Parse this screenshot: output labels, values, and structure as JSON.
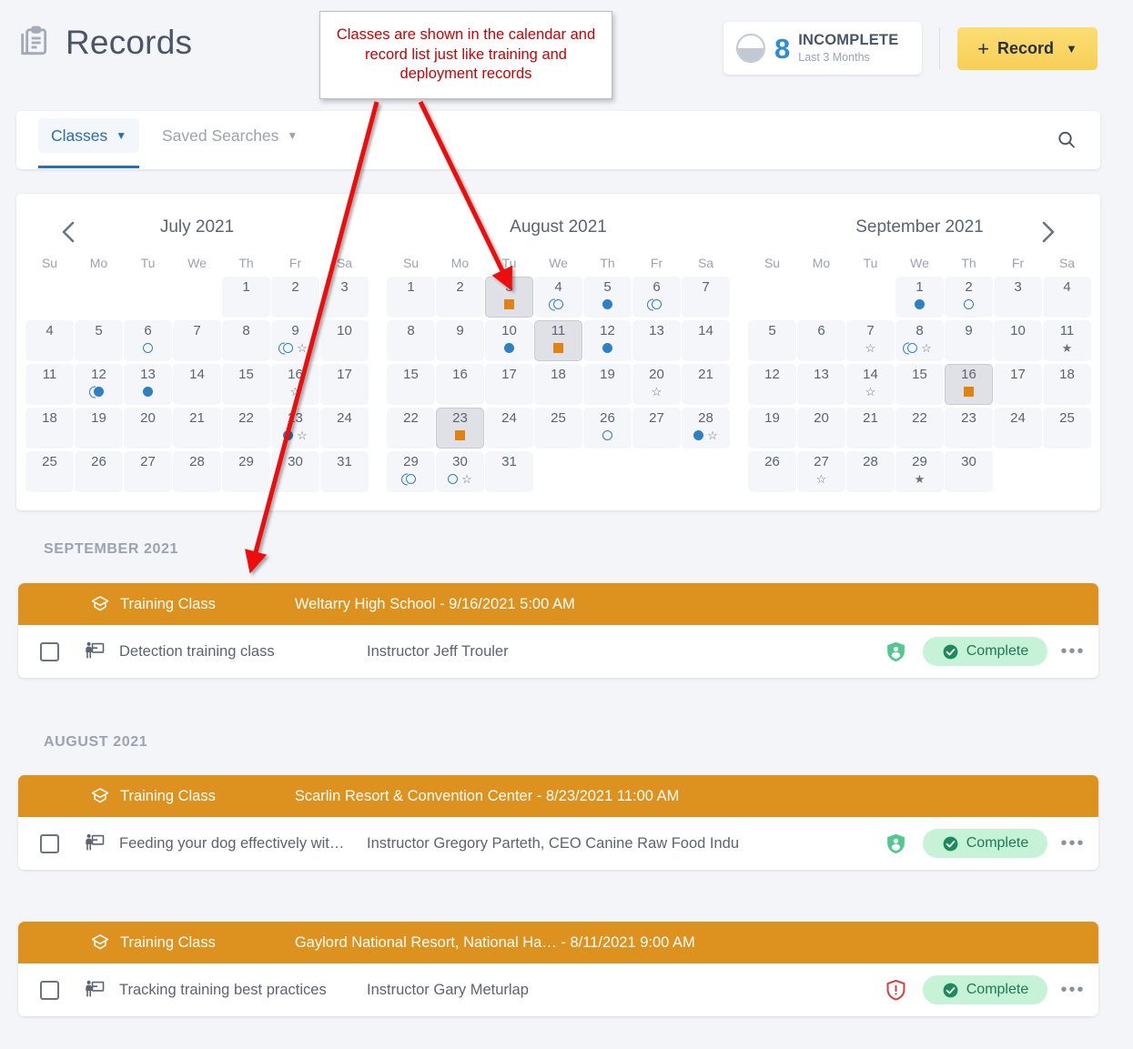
{
  "header": {
    "title": "Records",
    "clipboard_icon": "clipboard-icon",
    "kpi": {
      "count": "8",
      "label": "INCOMPLETE",
      "sub": "Last 3 Months",
      "icon": "half-filled-circle-icon"
    },
    "record_button": {
      "plus": "+",
      "label": "Record",
      "chevron": "⌄"
    }
  },
  "tabs": {
    "active": {
      "label": "Classes",
      "chevron": "⌄"
    },
    "inactive": {
      "label": "Saved Searches",
      "chevron": "⌄"
    },
    "search_icon": "search-icon"
  },
  "annotation": {
    "text": "Classes are shown in the calendar and record list  just like training and deployment records",
    "color": "#cc0000",
    "arrow_color": "#ee1111"
  },
  "calendar": {
    "prev_label": "‹",
    "next_label": "›",
    "dow": [
      "Su",
      "Mo",
      "Tu",
      "We",
      "Th",
      "Fr",
      "Sa"
    ],
    "legend_colors": {
      "dot": "#2e7fc4",
      "ring": "#2e7fc4",
      "square": "#e08214",
      "star": "#6b7381"
    },
    "months": [
      {
        "title": "July 2021",
        "lead_blanks": 4,
        "days": 31,
        "selected": [],
        "marks": {
          "6": [
            "ring"
          ],
          "9": [
            "crescent-ring",
            "star"
          ],
          "12": [
            "crescent-dot"
          ],
          "13": [
            "dot"
          ],
          "16": [
            "star"
          ],
          "23": [
            "dot",
            "star"
          ]
        }
      },
      {
        "title": "August 2021",
        "lead_blanks": 0,
        "days": 31,
        "selected": [
          "3",
          "11",
          "23"
        ],
        "marks": {
          "3": [
            "square"
          ],
          "4": [
            "crescent-ring"
          ],
          "5": [
            "dot"
          ],
          "6": [
            "crescent-ring"
          ],
          "10": [
            "dot"
          ],
          "11": [
            "square"
          ],
          "12": [
            "dot"
          ],
          "20": [
            "star"
          ],
          "23": [
            "square"
          ],
          "26": [
            "ring"
          ],
          "28": [
            "dot",
            "star"
          ],
          "29": [
            "crescent-ring"
          ],
          "30": [
            "ring",
            "star"
          ]
        }
      },
      {
        "title": "September 2021",
        "lead_blanks": 3,
        "days": 30,
        "selected": [
          "16"
        ],
        "marks": {
          "1": [
            "dot"
          ],
          "2": [
            "ring"
          ],
          "7": [
            "star"
          ],
          "8": [
            "crescent-ring",
            "star"
          ],
          "11": [
            "star-filled"
          ],
          "14": [
            "star"
          ],
          "16": [
            "square"
          ],
          "27": [
            "star"
          ],
          "29": [
            "star-filled"
          ]
        }
      }
    ]
  },
  "record_groups": [
    {
      "label": "SEPTEMBER 2021",
      "cards": [
        {
          "type": "Training Class",
          "location": "Weltarry High School - 9/16/2021 5:00 AM",
          "name": "Detection training class",
          "instructor": "Instructor Jeff Trouler",
          "shield": "shield-person-icon",
          "shield_color": "#4ecb8c",
          "status": "Complete",
          "menu": "•••"
        }
      ]
    },
    {
      "label": "AUGUST 2021",
      "cards": [
        {
          "type": "Training Class",
          "location": "Scarlin Resort & Convention Center - 8/23/2021 11:00 AM",
          "name": "Feeding your dog effectively wit…",
          "instructor": "Instructor Gregory Parteth, CEO Canine Raw Food Indu",
          "shield": "shield-person-icon",
          "shield_color": "#4ecb8c",
          "status": "Complete",
          "menu": "•••"
        },
        {
          "type": "Training Class",
          "location": "Gaylord National Resort, National Ha… - 8/11/2021 9:00 AM",
          "name": "Tracking training best practices",
          "instructor": "Instructor Gary Meturlap",
          "shield": "shield-alert-icon",
          "shield_color": "#d93a3a",
          "status": "Complete",
          "menu": "•••"
        }
      ]
    }
  ],
  "colors": {
    "page_bg": "#f4f5f8",
    "card_header": "#dd911f",
    "accent_blue": "#2a6fb5",
    "badge_bg": "#c6f2d8",
    "badge_text": "#1d7a54",
    "record_button": "#f8cf56"
  }
}
